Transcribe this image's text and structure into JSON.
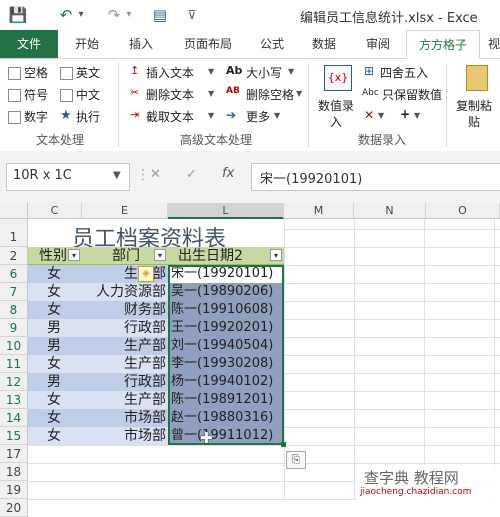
{
  "window": {
    "title": "编辑员工信息统计.xlsx - Exce"
  },
  "quick_access": [
    {
      "icon": "save-icon",
      "glyph": "💾"
    },
    {
      "icon": "undo-icon",
      "glyph": "↶"
    },
    {
      "icon": "undo-dropdown-icon",
      "glyph": "▾"
    },
    {
      "icon": "redo-icon",
      "glyph": "↷"
    },
    {
      "icon": "redo-dropdown-icon",
      "glyph": "▾"
    },
    {
      "icon": "form-icon",
      "glyph": "▤"
    },
    {
      "icon": "customize-icon",
      "glyph": "⊽"
    }
  ],
  "tabs": [
    "文件",
    "开始",
    "插入",
    "页面布局",
    "公式",
    "数据",
    "审阅",
    "方方格子",
    "视"
  ],
  "ribbon": {
    "text_processing": {
      "checks": [
        "空格",
        "英文",
        "符号",
        "中文",
        "数字"
      ],
      "execute": "执行",
      "execute_glyph": "★",
      "group_label": "文本处理"
    },
    "advanced_text": {
      "items": [
        {
          "label": "插入文本",
          "glyph": "↥"
        },
        {
          "label": "删除文本",
          "glyph": "✂"
        },
        {
          "label": "截取文本",
          "glyph": "⇥"
        },
        {
          "label": "大小写",
          "glyph": "Ab"
        },
        {
          "label": "删除空格",
          "glyph": "AB"
        },
        {
          "label": "更多",
          "glyph": "➔"
        }
      ],
      "group_label": "高级文本处理"
    },
    "numeric_entry": {
      "big_button_line1": "数值录",
      "big_button_line2": "入",
      "items": [
        {
          "label": "四舍五入",
          "glyph": "⊞"
        },
        {
          "label": "只保留数值",
          "glyph": "Abc"
        },
        {
          "label": "",
          "glyph": "✕"
        },
        {
          "label": "",
          "glyph": "+"
        }
      ],
      "group_label": "数据录入"
    },
    "copy_paste": {
      "line1": "复制粘",
      "line2": "贴"
    }
  },
  "formula_bar": {
    "name_box": "10R x 1C",
    "cancel_glyph": "✕",
    "enter_glyph": "✓",
    "fx": "fx",
    "content": "宋一(19920101)"
  },
  "sheet": {
    "columns": [
      "C",
      "E",
      "L",
      "M",
      "N",
      "O"
    ],
    "rows": [
      "1",
      "2",
      "6",
      "7",
      "8",
      "9",
      "10",
      "11",
      "12",
      "13",
      "14",
      "15",
      "17",
      "18",
      "19",
      "20"
    ],
    "title": "员工档案资料表",
    "headers": {
      "gender": "性别",
      "dept": "部门",
      "birth": "出生日期2"
    },
    "filter_glyph": "▾",
    "warning_glyph": "◈",
    "data": [
      {
        "gender": "女",
        "dept": "生产部",
        "birth": "宋一(19920101)"
      },
      {
        "gender": "女",
        "dept": "人力资源部",
        "birth": "吴一(19890206)"
      },
      {
        "gender": "女",
        "dept": "财务部",
        "birth": "陈一(19910608)"
      },
      {
        "gender": "男",
        "dept": "行政部",
        "birth": "王一(19920201)"
      },
      {
        "gender": "男",
        "dept": "生产部",
        "birth": "刘一(19940504)"
      },
      {
        "gender": "女",
        "dept": "生产部",
        "birth": "李一(19930208)"
      },
      {
        "gender": "男",
        "dept": "行政部",
        "birth": "杨一(19940102)"
      },
      {
        "gender": "女",
        "dept": "生产部",
        "birth": "陈一(19891201)"
      },
      {
        "gender": "女",
        "dept": "市场部",
        "birth": "赵一(19880316)"
      },
      {
        "gender": "女",
        "dept": "市场部",
        "birth": "曾一(19911012)"
      }
    ],
    "paste_options_glyph": "⎘",
    "cursor_glyph": "✚"
  },
  "watermark": {
    "line1": "查字典 教程网",
    "line2": "jiaocheng.chazidian.com"
  },
  "colors": {
    "accent": "#217346",
    "header_fill": "#c5d9a1",
    "band_a": "#bfcde9",
    "band_b": "#d9e1f2",
    "selection": "#8fa0bf",
    "title_text": "#44546a"
  }
}
